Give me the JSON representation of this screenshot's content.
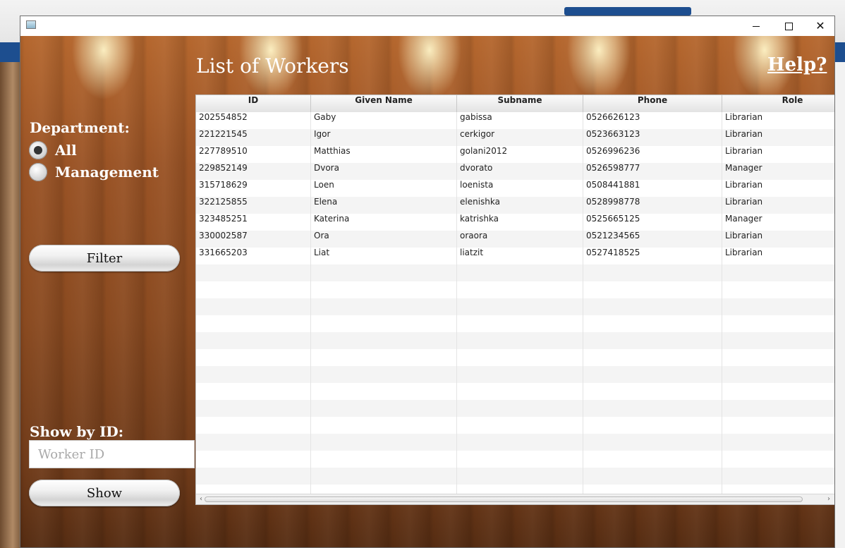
{
  "window": {
    "title": "",
    "controls": {
      "minimize": "minimize",
      "maximize": "maximize",
      "close": "✕"
    }
  },
  "header": {
    "title": "List of Workers",
    "help": "Help?"
  },
  "filters": {
    "department_label": "Department:",
    "options": [
      {
        "label": "All",
        "selected": true
      },
      {
        "label": "Management",
        "selected": false
      }
    ],
    "filter_button": "Filter"
  },
  "show_by_id": {
    "label": "Show by ID:",
    "placeholder": "Worker ID",
    "value": "",
    "button": "Show"
  },
  "table": {
    "columns": [
      "ID",
      "Given Name",
      "Subname",
      "Phone",
      "Role"
    ],
    "rows": [
      [
        "202554852",
        "Gaby",
        "gabissa",
        "0526626123",
        "Librarian"
      ],
      [
        "221221545",
        "Igor",
        "cerkigor",
        "0523663123",
        "Librarian"
      ],
      [
        "227789510",
        "Matthias",
        "golani2012",
        "0526996236",
        "Librarian"
      ],
      [
        "229852149",
        "Dvora",
        "dvorato",
        "0526598777",
        "Manager"
      ],
      [
        "315718629",
        "Loen",
        "loenista",
        "0508441881",
        "Librarian"
      ],
      [
        "322125855",
        "Elena",
        "elenishka",
        "0528998778",
        "Librarian"
      ],
      [
        "323485251",
        "Katerina",
        "katrishka",
        "0525665125",
        "Manager"
      ],
      [
        "330002587",
        "Ora",
        "oraora",
        "0521234565",
        "Librarian"
      ],
      [
        "331665203",
        "Liat",
        "liatzit",
        "0527418525",
        "Librarian"
      ]
    ],
    "empty_rows": 14
  },
  "colors": {
    "wood": "#8a4a20",
    "header_bg": "#e3e3e3",
    "text_white": "#ffffff"
  }
}
